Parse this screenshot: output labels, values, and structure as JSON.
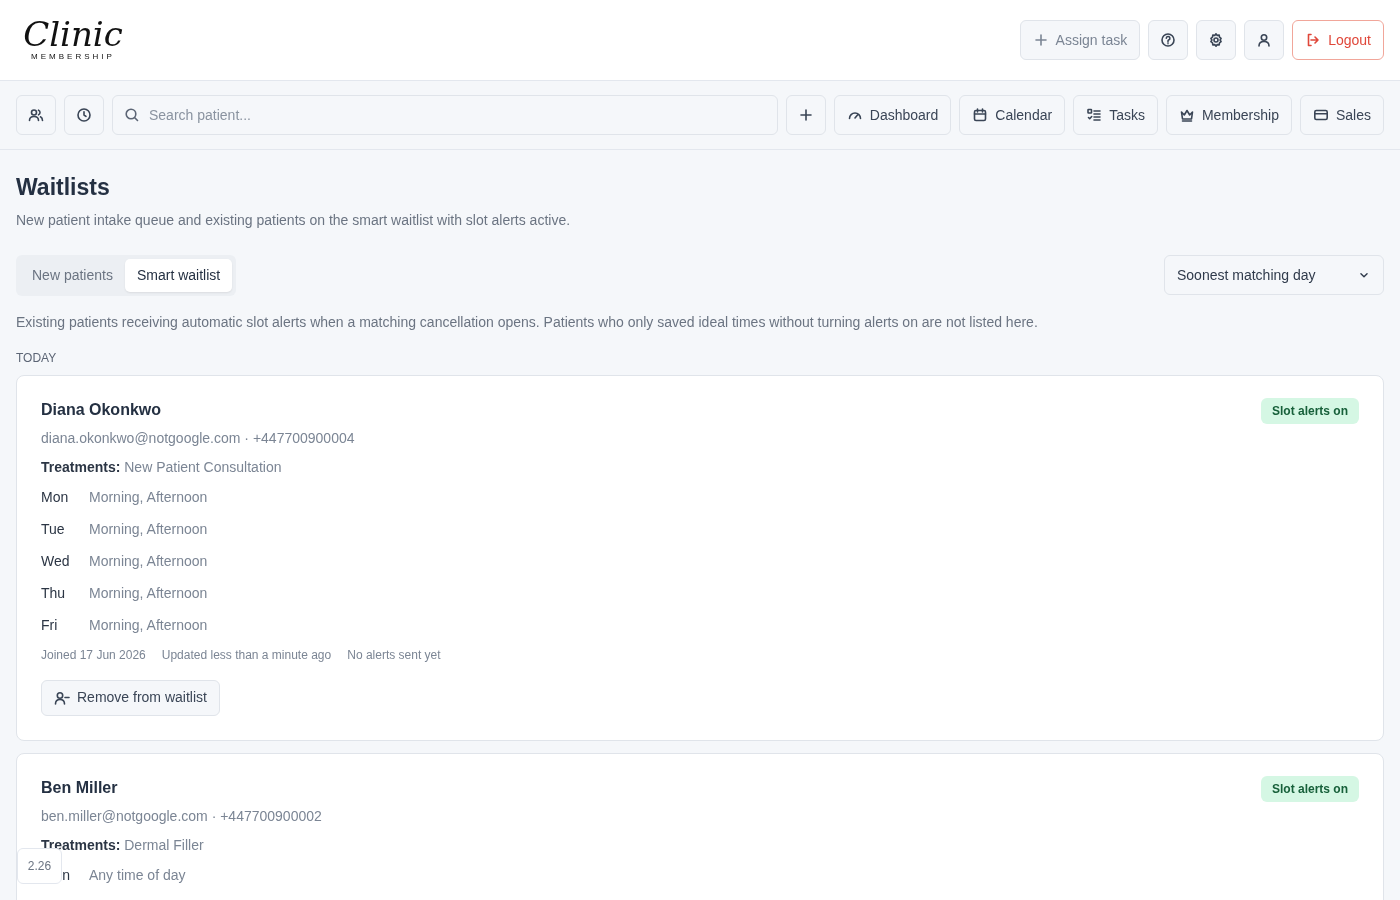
{
  "header": {
    "logo": {
      "script": "Clinic",
      "subtitle": "MEMBERSHIP"
    },
    "actions": [
      {
        "kind": "text",
        "label": "Assign task"
      },
      {
        "kind": "icon"
      },
      {
        "kind": "icon"
      },
      {
        "kind": "icon"
      },
      {
        "kind": "danger",
        "label": "Logout"
      }
    ]
  },
  "toolbar": {
    "search": {
      "placeholder": "Search patient..."
    },
    "nav": [
      {
        "label": "Dashboard"
      },
      {
        "label": "Calendar"
      },
      {
        "label": "Tasks"
      },
      {
        "label": "Membership"
      },
      {
        "label": "Sales"
      }
    ]
  },
  "page": {
    "title": "Waitlists",
    "subtitle": "New patient intake queue and existing patients on the smart waitlist with slot alerts active."
  },
  "tabs": [
    {
      "label": "New patients",
      "selected": false
    },
    {
      "label": "Smart waitlist",
      "selected": true
    }
  ],
  "sort": {
    "value": "Soonest matching day"
  },
  "note": "Existing patients receiving automatic slot alerts when a matching cancellation opens. Patients who only saved ideal times without turning alerts on are not listed here.",
  "section": "TODAY",
  "patients": [
    {
      "name": "Diana Okonkwo",
      "contact": "diana.okonkwo@notgoogle.com · +447700900004",
      "badge": "Slot alerts on",
      "treatments_label": "Treatments:",
      "treatments": "New Patient Consultation",
      "days": [
        {
          "day": "Mon",
          "times": "Morning, Afternoon"
        },
        {
          "day": "Tue",
          "times": "Morning, Afternoon"
        },
        {
          "day": "Wed",
          "times": "Morning, Afternoon"
        },
        {
          "day": "Thu",
          "times": "Morning, Afternoon"
        },
        {
          "day": "Fri",
          "times": "Morning, Afternoon"
        }
      ],
      "meta": [
        "Joined 17 Jun 2026",
        "Updated less than a minute ago",
        "No alerts sent yet"
      ],
      "action": "Remove from waitlist"
    },
    {
      "name": "Ben Miller",
      "contact": "ben.miller@notgoogle.com · +447700900002",
      "badge": "Slot alerts on",
      "treatments_label": "Treatments:",
      "treatments": "Dermal Filler",
      "days": [
        {
          "day": "n",
          "kind": "partial",
          "times": "Any time of day"
        }
      ]
    }
  ],
  "version": "2.26"
}
